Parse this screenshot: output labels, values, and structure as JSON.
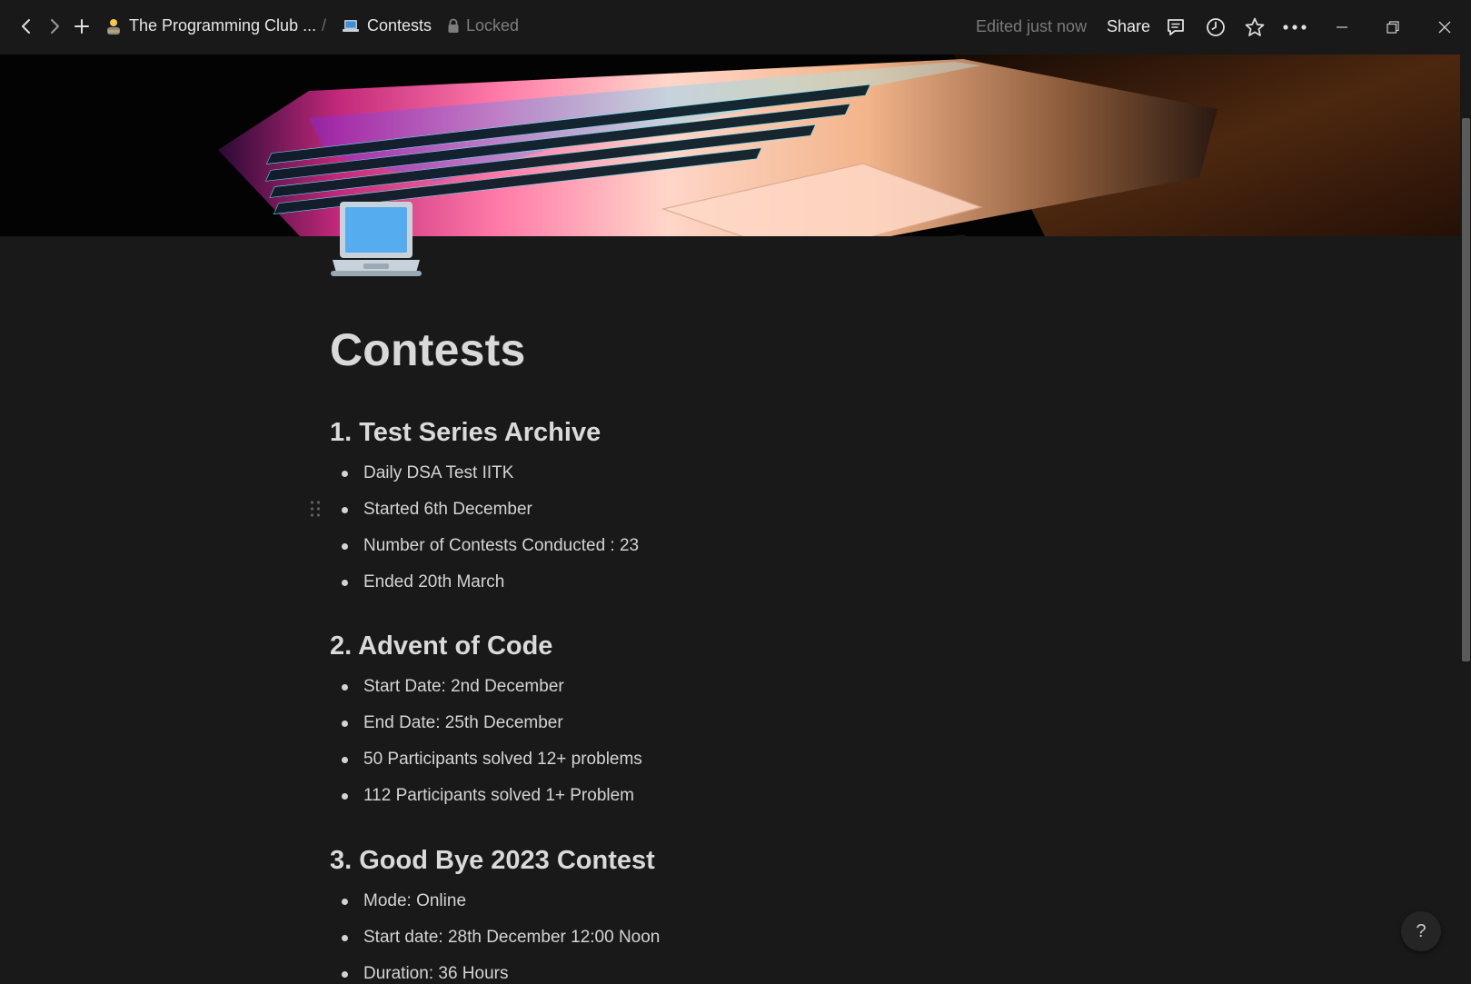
{
  "topbar": {
    "breadcrumb": [
      {
        "label": "The Programming Club ...",
        "icon": "person-emoji-icon"
      },
      {
        "label": "Contests",
        "icon": "laptop-emoji-icon"
      }
    ],
    "separator": "/",
    "locked_label": "Locked",
    "edited_label": "Edited just now",
    "share_label": "Share"
  },
  "page": {
    "title": "Contests",
    "icon": "laptop-icon"
  },
  "sections": [
    {
      "heading": "1. Test Series Archive",
      "items": [
        "Daily DSA Test IITK",
        "Started 6th December",
        "Number of Contests Conducted : 23",
        "Ended 20th March"
      ]
    },
    {
      "heading": "2. Advent of Code",
      "items": [
        "Start Date: 2nd December",
        "End Date: 25th December",
        "50 Participants solved 12+ problems",
        "112 Participants solved 1+ Problem"
      ]
    },
    {
      "heading": "3. Good Bye 2023 Contest",
      "items": [
        "Mode: Online",
        "Start date: 28th December 12:00 Noon",
        "Duration: 36 Hours"
      ]
    }
  ],
  "help_label": "?",
  "colors": {
    "background": "#191919",
    "text": "#d4d4d4",
    "muted": "#7a7a7a"
  }
}
